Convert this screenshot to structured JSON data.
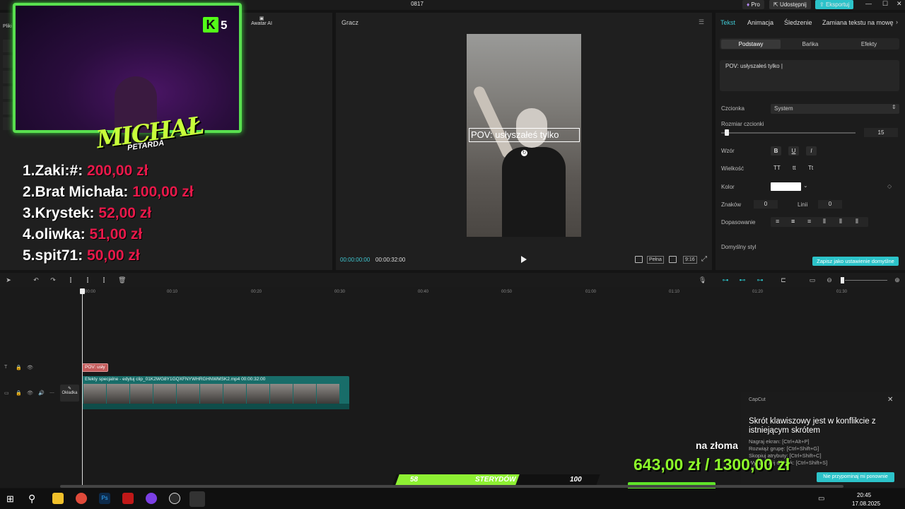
{
  "app": {
    "title": "0817",
    "pro_label": "Pro",
    "share_label": "Udostępnij",
    "export_label": "Eksportuj",
    "brand_color": "#2cc3c9"
  },
  "media_panel": {
    "files_label": "Pliki",
    "avatar_label": "Awatar AI"
  },
  "stream_overlay": {
    "kick_count": "5",
    "logo_text": "MICHAŁ",
    "logo_sub": "PETARDA",
    "donors": [
      {
        "name": "1.Zaki:#:",
        "amount": "200,00 zł"
      },
      {
        "name": "2.Brat Michała:",
        "amount": "100,00 zł"
      },
      {
        "name": "3.Krystek:",
        "amount": "52,00 zł"
      },
      {
        "name": "4.oliwka:",
        "amount": "51,00 zł"
      },
      {
        "name": "5.spit71:",
        "amount": "50,00 zł"
      }
    ],
    "goal_label": "na złoma",
    "goal_amount": "643,00 zł / 1300,00 zł",
    "goal_progress": 0.49,
    "steroid_left": "58",
    "steroid_label": "STERYDÓW",
    "steroid_right": "100"
  },
  "player": {
    "title": "Gracz",
    "caption": "POV: usłyszałeś tylko",
    "time_current": "00:00:00:00",
    "time_total": "00:00:32:00",
    "full_label": "Pełna",
    "ratio_label": "9:16"
  },
  "properties": {
    "tabs": [
      "Tekst",
      "Animacja",
      "Śledzenie",
      "Zamiana tekstu na mowę"
    ],
    "subtabs": [
      "Podstawy",
      "Bańka",
      "Efekty"
    ],
    "text_value": "POV: usłyszałeś tylko |",
    "font_label": "Czcionka",
    "font_value": "System",
    "size_label": "Rozmiar czcionki",
    "size_value": "15",
    "pattern_label": "Wzór",
    "case_label": "Wielkość",
    "case_options": [
      "TT",
      "tt",
      "Tt"
    ],
    "color_label": "Kolor",
    "chars_label": "Znaków",
    "chars_value": "0",
    "lines_label": "Linii",
    "lines_value": "0",
    "align_label": "Dopasowanie",
    "default_style_label": "Domyślny styl",
    "save_default_label": "Zapisz jako ustawienie domyślne"
  },
  "timeline": {
    "ticks": [
      "00:00",
      "00:10",
      "00:20",
      "00:30",
      "00:40",
      "00:50",
      "01:00",
      "01:10",
      "01:20",
      "01:30"
    ],
    "text_clip": "POV: usły",
    "video_clip_label": "Efekty specjalne - edytuj   clip_01K2WG8Y1GQXFNYWHRGHNWMSK2.mp4   00:00:32:00",
    "cover_label": "Okładka"
  },
  "notification": {
    "app": "CapCut",
    "title": "Skrót klawiszowy jest w konflikcie z istniejącym skrótem",
    "lines": [
      "Nagraj ekran: [Ctrl+Alt+P]",
      "Rozwiąż grupę: [Ctrl+Shift+G]",
      "Skopiuj atrybuty: [Ctrl+Shift+C]",
      "Wyodrębnij dźwięk: [Ctrl+Shift+S]"
    ],
    "remind_label": "Nie przypominaj mi ponownie"
  },
  "taskbar": {
    "time": "20:45",
    "date": "17.08.2025"
  }
}
